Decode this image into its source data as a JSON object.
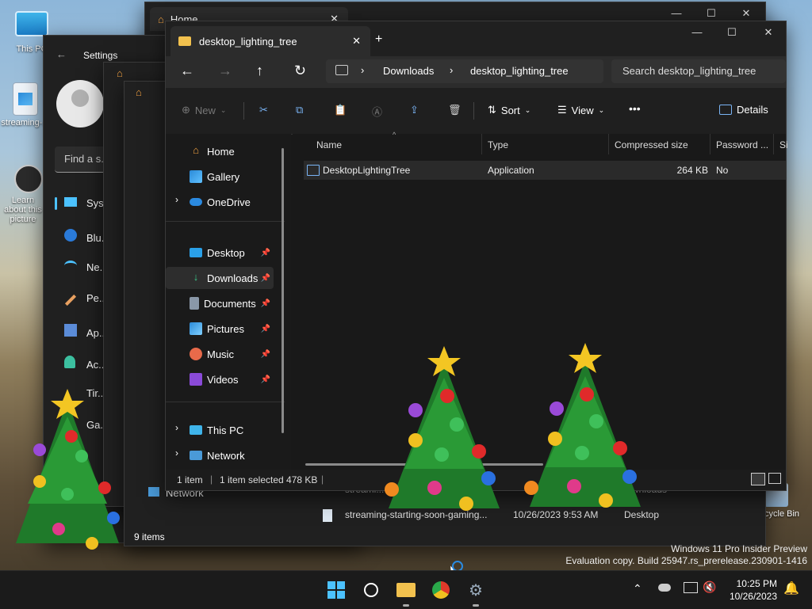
{
  "desktop": {
    "icons": [
      {
        "label": "This PC"
      },
      {
        "label": "streaming-..."
      },
      {
        "label": "Learn about this picture"
      },
      {
        "label": "Recycle Bin"
      }
    ],
    "watermark": {
      "line1": "Windows 11 Pro Insider Preview",
      "line2": "Evaluation copy. Build 25947.rs_prerelease.230901-1416"
    }
  },
  "back_window_home": {
    "tab_title": "Home",
    "network_label": "Network",
    "items_count": "9 items",
    "row_name": "streaming-starting-soon-gaming...",
    "row_date": "10/26/2023 9:53 AM",
    "row_location": "Desktop",
    "row2_name": "streami...",
    "row2_location": "...wnloads"
  },
  "settings_window": {
    "title": "Settings",
    "search_placeholder": "Find a s...",
    "items": [
      {
        "label": "Sys..."
      },
      {
        "label": "Blu..."
      },
      {
        "label": "Ne..."
      },
      {
        "label": "Pe..."
      },
      {
        "label": "Ap..."
      },
      {
        "label": "Ac..."
      },
      {
        "label": "Tir..."
      },
      {
        "label": "Ga..."
      }
    ]
  },
  "explorer": {
    "tab_title": "desktop_lighting_tree",
    "add_tab": "+",
    "address": {
      "segments": [
        "Downloads",
        "desktop_lighting_tree"
      ]
    },
    "search_placeholder": "Search desktop_lighting_tree",
    "toolbar": {
      "new_label": "New",
      "sort_label": "Sort",
      "view_label": "View",
      "more_label": "•••",
      "details_label": "Details"
    },
    "nav": {
      "home": "Home",
      "gallery": "Gallery",
      "onedrive": "OneDrive",
      "desktop": "Desktop",
      "downloads": "Downloads",
      "documents": "Documents",
      "pictures": "Pictures",
      "music": "Music",
      "videos": "Videos",
      "thispc": "This PC",
      "network": "Network"
    },
    "columns": {
      "name": "Name",
      "type": "Type",
      "compressed": "Compressed size",
      "password": "Password ...",
      "size": "Si"
    },
    "files": [
      {
        "name": "DesktopLightingTree",
        "type": "Application",
        "compressed": "264 KB",
        "password": "No"
      }
    ],
    "status": {
      "count": "1 item",
      "selected": "1 item selected  478 KB"
    }
  },
  "taskbar": {
    "time": "10:25 PM",
    "date": "10/26/2023"
  }
}
